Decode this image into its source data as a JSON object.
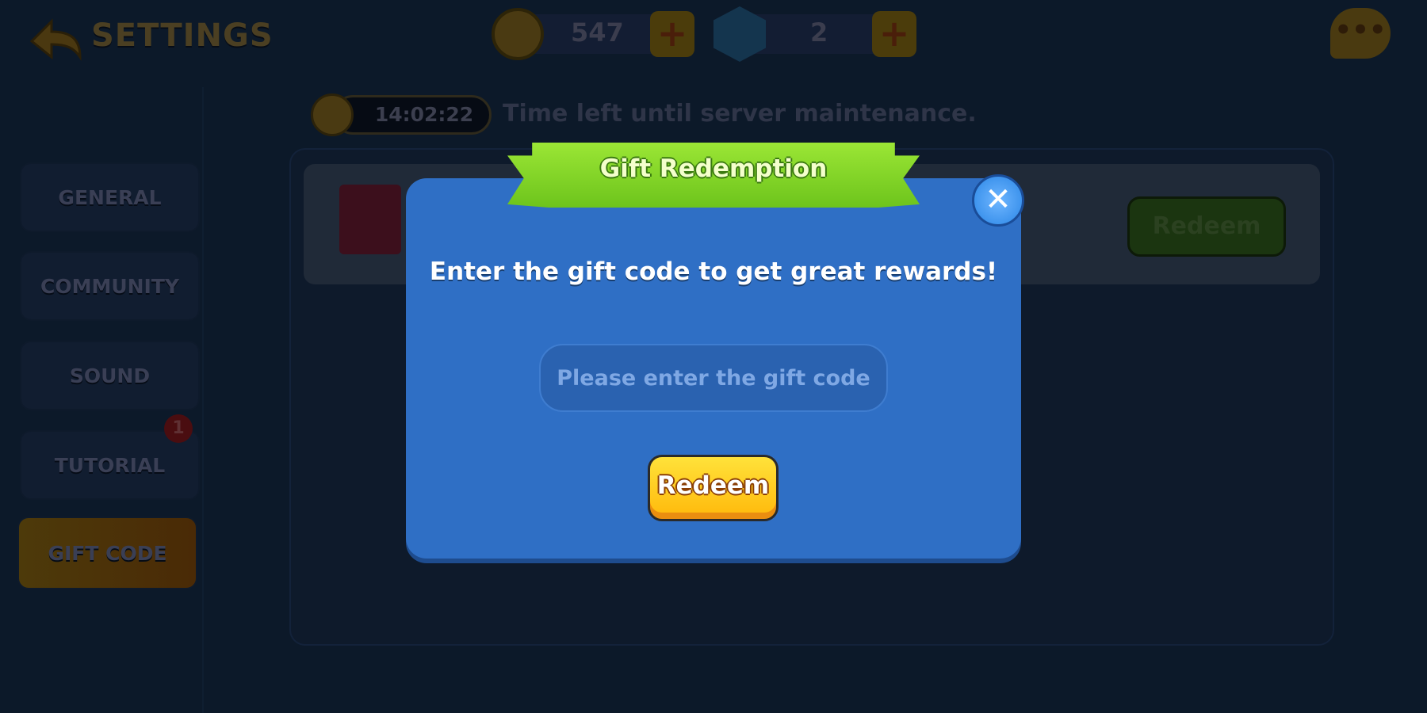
{
  "header": {
    "title": "SETTINGS",
    "coins": "547",
    "gems": "2",
    "plus": "+",
    "chat": "•••"
  },
  "maintenance": {
    "timer": "14:02:22",
    "text": "Time left until server maintenance."
  },
  "sidebar": {
    "items": [
      {
        "label": "GENERAL"
      },
      {
        "label": "COMMUNITY"
      },
      {
        "label": "SOUND"
      },
      {
        "label": "TUTORIAL",
        "badge": "1"
      },
      {
        "label": "GIFT CODE",
        "active": true
      }
    ]
  },
  "panel": {
    "redeem_label": "Redeem"
  },
  "modal": {
    "title": "Gift Redemption",
    "close": "✕",
    "prompt": "Enter the gift code to get great rewards!",
    "input_placeholder": "Please enter the gift code",
    "input_value": "",
    "redeem_label": "Redeem"
  },
  "colors": {
    "modal": "#2f6fc5",
    "ribbon": "#8ad82a",
    "redeem": "#ffc81a",
    "background": "#0c1929"
  }
}
